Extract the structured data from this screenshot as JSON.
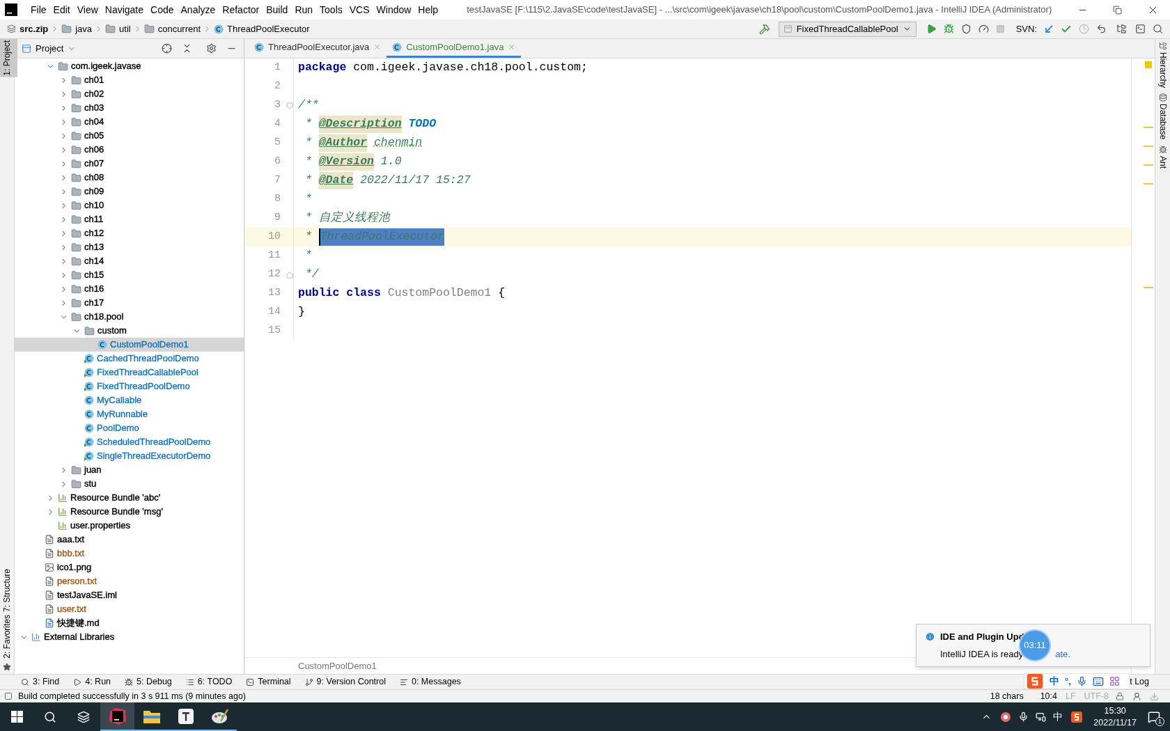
{
  "window": {
    "title": "testJavaSE [F:\\115\\2.JavaSE\\code\\testJavaSE] - ...\\src\\com\\igeek\\javase\\ch18\\pool\\custom\\CustomPoolDemo1.java - IntelliJ IDEA (Administrator)"
  },
  "menu": [
    "File",
    "Edit",
    "View",
    "Navigate",
    "Code",
    "Analyze",
    "Refactor",
    "Build",
    "Run",
    "Tools",
    "VCS",
    "Window",
    "Help"
  ],
  "nav_path": [
    {
      "label": "src.zip",
      "kind": "archive"
    },
    {
      "label": "java",
      "kind": "folder"
    },
    {
      "label": "util",
      "kind": "folder"
    },
    {
      "label": "concurrent",
      "kind": "folder"
    },
    {
      "label": "ThreadPoolExecutor",
      "kind": "class"
    }
  ],
  "run_config": "FixedThreadCallablePool",
  "svn_label": "SVN:",
  "left_stripe": [
    {
      "label": "1: Project",
      "selected": true
    },
    {
      "label": "7: Structure",
      "selected": false
    },
    {
      "label": "2: Favorites",
      "selected": false
    }
  ],
  "right_stripe": [
    {
      "label": "Hierarchy",
      "kind": "hierarchy"
    },
    {
      "label": "Database",
      "kind": "database"
    },
    {
      "label": "Ant",
      "kind": "ant"
    }
  ],
  "project_panel": {
    "title": "Project"
  },
  "tree": {
    "inner_items": [
      {
        "label": "com.igeek.javase",
        "kind": "package",
        "color": "#000000",
        "expanded": true,
        "selected": false,
        "children": [
          {
            "label": "ch01",
            "kind": "folder",
            "color": "#000000",
            "expanded": false,
            "selected": false
          },
          {
            "label": "ch02",
            "kind": "folder",
            "color": "#000000",
            "expanded": false,
            "selected": false
          },
          {
            "label": "ch03",
            "kind": "folder",
            "color": "#000000",
            "expanded": false,
            "selected": false
          },
          {
            "label": "ch04",
            "kind": "folder",
            "color": "#000000",
            "expanded": false,
            "selected": false
          },
          {
            "label": "ch05",
            "kind": "folder",
            "color": "#000000",
            "expanded": false,
            "selected": false
          },
          {
            "label": "ch06",
            "kind": "folder",
            "color": "#000000",
            "expanded": false,
            "selected": false
          },
          {
            "label": "ch07",
            "kind": "folder",
            "color": "#000000",
            "expanded": false,
            "selected": false
          },
          {
            "label": "ch08",
            "kind": "folder",
            "color": "#000000",
            "expanded": false,
            "selected": false
          },
          {
            "label": "ch09",
            "kind": "folder",
            "color": "#000000",
            "expanded": false,
            "selected": false
          },
          {
            "label": "ch10",
            "kind": "folder",
            "color": "#000000",
            "expanded": false,
            "selected": false
          },
          {
            "label": "ch11",
            "kind": "folder",
            "color": "#000000",
            "expanded": false,
            "selected": false
          },
          {
            "label": "ch12",
            "kind": "folder",
            "color": "#000000",
            "expanded": false,
            "selected": false
          },
          {
            "label": "ch13",
            "kind": "folder",
            "color": "#000000",
            "expanded": false,
            "selected": false
          },
          {
            "label": "ch14",
            "kind": "folder",
            "color": "#000000",
            "expanded": false,
            "selected": false
          },
          {
            "label": "ch15",
            "kind": "folder",
            "color": "#000000",
            "expanded": false,
            "selected": false
          },
          {
            "label": "ch16",
            "kind": "folder",
            "color": "#000000",
            "expanded": false,
            "selected": false
          },
          {
            "label": "ch17",
            "kind": "folder",
            "color": "#000000",
            "expanded": false,
            "selected": false
          },
          {
            "label": "ch18.pool",
            "kind": "folder",
            "color": "#000000",
            "expanded": true,
            "selected": false,
            "children": [
              {
                "label": "custom",
                "kind": "folder",
                "color": "#000000",
                "expanded": true,
                "selected": false,
                "children": [
                  {
                    "label": "CustomPoolDemo1",
                    "kind": "class",
                    "color": "#1f76b3",
                    "selected": true
                  }
                ]
              },
              {
                "label": "CachedThreadPoolDemo",
                "kind": "runnable_class",
                "color": "#1f76b3",
                "selected": false
              },
              {
                "label": "FixedThreadCallablePool",
                "kind": "runnable_class",
                "color": "#1f76b3",
                "selected": false
              },
              {
                "label": "FixedThreadPoolDemo",
                "kind": "runnable_class",
                "color": "#1f76b3",
                "selected": false
              },
              {
                "label": "MyCallable",
                "kind": "class",
                "color": "#1f76b3",
                "selected": false
              },
              {
                "label": "MyRunnable",
                "kind": "class",
                "color": "#1f76b3",
                "selected": false
              },
              {
                "label": "PoolDemo",
                "kind": "class",
                "color": "#1f76b3",
                "selected": false
              },
              {
                "label": "ScheduledThreadPoolDemo",
                "kind": "runnable_class",
                "color": "#1f76b3",
                "selected": false
              },
              {
                "label": "SingleThreadExecutorDemo",
                "kind": "runnable_class",
                "color": "#1f76b3",
                "selected": false
              }
            ]
          },
          {
            "label": "juan",
            "kind": "folder",
            "color": "#000000",
            "expanded": false,
            "selected": false
          },
          {
            "label": "stu",
            "kind": "folder",
            "color": "#000000",
            "expanded": false,
            "selected": false
          }
        ]
      },
      {
        "label": "Resource Bundle 'abc'",
        "kind": "bundle",
        "color": "#000000",
        "expanded": false,
        "selected": false
      },
      {
        "label": "Resource Bundle 'msg'",
        "kind": "bundle",
        "color": "#000000",
        "expanded": false,
        "selected": false
      },
      {
        "label": "user.properties",
        "kind": "properties",
        "color": "#000000",
        "selected": false
      }
    ],
    "project_items": [
      {
        "label": "aaa.txt",
        "kind": "text",
        "color": "#000000",
        "selected": false
      },
      {
        "label": "bbb.txt",
        "kind": "text",
        "color": "#9a5a1f",
        "selected": false
      },
      {
        "label": "ico1.png",
        "kind": "image",
        "color": "#000000",
        "selected": false
      },
      {
        "label": "person.txt",
        "kind": "text",
        "color": "#9a5a1f",
        "selected": false
      },
      {
        "label": "testJavaSE.iml",
        "kind": "text",
        "color": "#000000",
        "selected": false
      },
      {
        "label": "user.txt",
        "kind": "text",
        "color": "#9a5a1f",
        "selected": false
      },
      {
        "label": "快捷键.md",
        "kind": "markdown",
        "color": "#000000",
        "selected": false
      }
    ],
    "top_items": [
      {
        "label": "External Libraries",
        "kind": "libraries",
        "color": "#000000",
        "expanded": true,
        "selected": false
      }
    ]
  },
  "tabs": [
    {
      "label": "ThreadPoolExecutor.java",
      "selected": false
    },
    {
      "label": "CustomPoolDemo1.java",
      "selected": true
    }
  ],
  "code": [
    {
      "number": "1",
      "current": false,
      "tokens": [
        {
          "t": "package ",
          "kind": "keyword"
        },
        {
          "t": "com.igeek.javase.ch18.pool.custom;",
          "kind": "text"
        }
      ]
    },
    {
      "number": "2",
      "current": false
    },
    {
      "number": "3",
      "current": false,
      "fold_start": true,
      "tokens": [
        {
          "t": "/**",
          "kind": "comment"
        }
      ]
    },
    {
      "number": "4",
      "current": false,
      "tokens": [
        {
          "t": " * ",
          "kind": "comment"
        },
        {
          "t": "@Description",
          "kind": "tag"
        },
        {
          "t": "TODO",
          "kind": "todo"
        }
      ]
    },
    {
      "number": "5",
      "current": false,
      "tokens": [
        {
          "t": " * ",
          "kind": "comment"
        },
        {
          "t": "@Author",
          "kind": "tag"
        },
        {
          "t": "chenmin",
          "kind": "typo"
        }
      ]
    },
    {
      "number": "6",
      "current": false,
      "tokens": [
        {
          "t": " * ",
          "kind": "comment"
        },
        {
          "t": "@Version",
          "kind": "tag"
        },
        {
          "t": " 1.0",
          "kind": "comment"
        }
      ]
    },
    {
      "number": "7",
      "current": false,
      "tokens": [
        {
          "t": " * ",
          "kind": "comment"
        },
        {
          "t": "@Date",
          "kind": "tag"
        },
        {
          "t": " 2022/11/17 15:27",
          "kind": "comment"
        }
      ]
    },
    {
      "number": "8",
      "current": false,
      "tokens": [
        {
          "t": " *",
          "kind": "comment"
        }
      ]
    },
    {
      "number": "9",
      "current": false,
      "tokens": [
        {
          "t": " * 自定义线程池",
          "kind": "comment"
        }
      ]
    },
    {
      "number": "10",
      "current": true,
      "tokens": [
        {
          "t": " * ",
          "kind": "comment"
        },
        {
          "t": "ThreadPoolExecutor",
          "kind": "comment",
          "selected": true
        }
      ]
    },
    {
      "number": "11",
      "current": false,
      "tokens": [
        {
          "t": " *",
          "kind": "comment"
        }
      ]
    },
    {
      "number": "12",
      "current": false,
      "fold_end": true,
      "tokens": [
        {
          "t": " */",
          "kind": "comment"
        }
      ]
    },
    {
      "number": "13",
      "current": false,
      "tokens": [
        {
          "t": "public class ",
          "kind": "keyword"
        },
        {
          "t": "CustomPoolDemo1",
          "kind": "unused"
        },
        {
          "t": " {",
          "kind": "text"
        }
      ]
    },
    {
      "number": "14",
      "current": false,
      "tokens": [
        {
          "t": "}",
          "kind": "text"
        }
      ]
    },
    {
      "number": "15",
      "current": false
    }
  ],
  "editor_breadcrumb": "CustomPoolDemo1",
  "tool_buttons": [
    {
      "label": "3: Find",
      "kind": "find"
    },
    {
      "label": "4: Run",
      "kind": "run"
    },
    {
      "label": "5: Debug",
      "kind": "debug"
    },
    {
      "label": "6: TODO",
      "kind": "todo"
    },
    {
      "label": "Terminal",
      "kind": "terminal"
    },
    {
      "label": "9: Version Control",
      "kind": "vcs"
    },
    {
      "label": "0: Messages",
      "kind": "messages"
    }
  ],
  "event_log": "t Log",
  "status_bar": {
    "message": "Build completed successfully in 3 s 911 ms (9 minutes ago)",
    "chars": "18 chars",
    "position": "10:4",
    "line_separator": "LF",
    "encoding": "UTF-8"
  },
  "notification": {
    "title": "IDE and Plugin Upd",
    "body": "IntelliJ IDEA is ready",
    "link": "ate."
  },
  "timer": "03:11",
  "ime": {
    "mode": "中",
    "punct": "°,"
  },
  "taskbar": {
    "apps": [
      {
        "kind": "intellij",
        "selected": true
      },
      {
        "kind": "explorer",
        "selected": false
      },
      {
        "kind": "typora",
        "selected": false
      },
      {
        "kind": "paint",
        "selected": false
      }
    ],
    "ime": "中",
    "time": "15:30",
    "date": "2022/11/17",
    "notifications": "1"
  }
}
